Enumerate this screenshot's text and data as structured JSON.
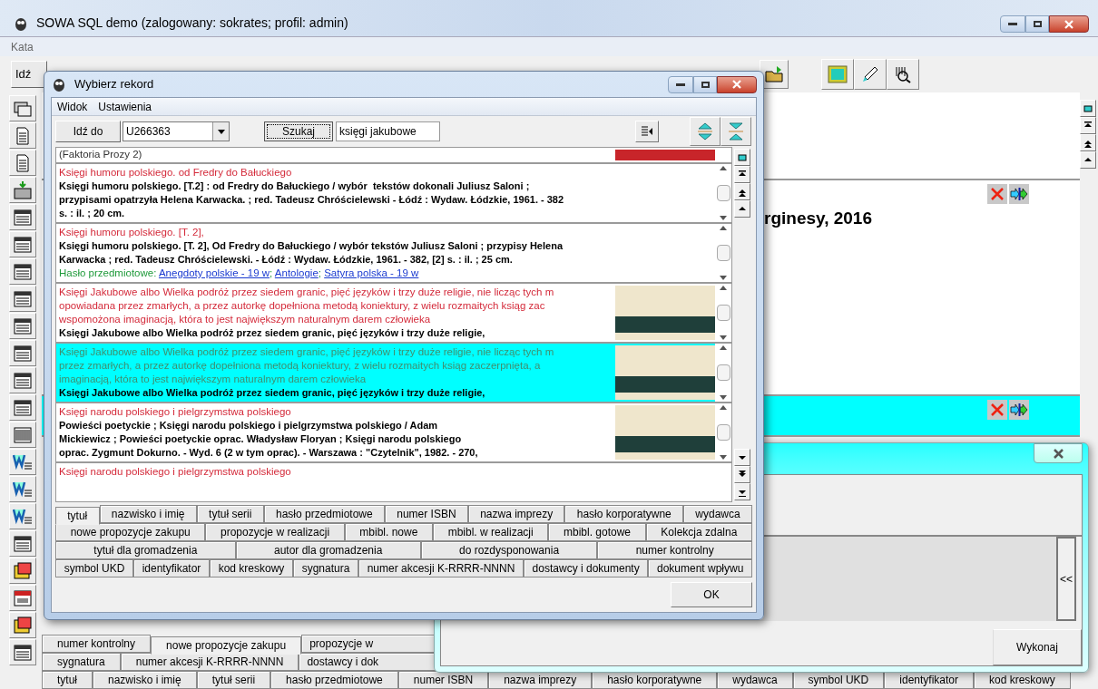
{
  "main_window": {
    "title": "SOWA SQL demo (zalogowany: sokrates; profil: admin)",
    "menu": [
      "Kata"
    ],
    "toolbar_button": "Idź",
    "records": [
      {
        "selected": false,
        "actions": false
      },
      {
        "selected": false,
        "actions": true,
        "text": "rginesy, 2016"
      },
      {
        "selected": true,
        "actions": true
      }
    ],
    "tab_rows": [
      [
        {
          "label": "numer kontrolny",
          "selected": false
        },
        {
          "label": "nowe propozycje zakupu",
          "selected": true
        },
        {
          "label": "propozycje w",
          "selected": false
        }
      ],
      [
        {
          "label": "sygnatura",
          "selected": false
        },
        {
          "label": "numer akcesji K-RRRR-NNNN",
          "selected": false
        },
        {
          "label": "dostawcy i dok",
          "selected": false
        }
      ],
      [
        {
          "label": "tytuł",
          "selected": false
        },
        {
          "label": "nazwisko i imię",
          "selected": false
        },
        {
          "label": "tytuł serii",
          "selected": false
        },
        {
          "label": "hasło przedmiotowe",
          "selected": false
        },
        {
          "label": "numer ISBN",
          "selected": false
        },
        {
          "label": "nazwa imprezy",
          "selected": false
        },
        {
          "label": "hasło korporatywne",
          "selected": false
        },
        {
          "label": "wydawca",
          "selected": false
        },
        {
          "label": "symbol UKD",
          "selected": false
        },
        {
          "label": "identyfikator",
          "selected": false
        },
        {
          "label": "kod kreskowy",
          "selected": false
        }
      ]
    ]
  },
  "dialog": {
    "title": "Wybierz rekord",
    "menu": [
      "Widok",
      "Ustawienia"
    ],
    "goto_button": "Idź do",
    "goto_value": "U266363",
    "search_button": "Szukaj",
    "search_value": "księgi jakubowe",
    "partial_record": "(Faktoria Prozy 2)",
    "records": [
      {
        "selected": false,
        "cover": false,
        "title_lines": [
          "Księgi humoru polskiego. od Fredry do Bałuckiego"
        ],
        "body_lines": [
          "Księgi humoru polskiego. [T.2] : od Fredry do Bałuckiego / wybór  tekstów dokonali Juliusz Saloni ;",
          "przypisami opatrzyła Helena Karwacka. ; red. Tadeusz Chróścielewski - Łódź : Wydaw. Łódzkie, 1961. - 382",
          "s. : il. ; 20 cm."
        ]
      },
      {
        "selected": false,
        "cover": false,
        "title_lines": [
          "Księgi humoru polskiego. [T. 2],"
        ],
        "body_lines": [
          "Księgi humoru polskiego. [T. 2], Od Fredry do Bałuckiego / wybór tekstów Juliusz Saloni ; przypisy Helena",
          "Karwacka ; red. Tadeusz Chróścielewski. - Łódź : Wydaw. Łódzkie, 1961. - 382, [2] s. : il. ; 25 cm."
        ],
        "subject": {
          "label": "Hasło przedmiotowe:",
          "separator": ";",
          "links": [
            "Anegdoty polskie - 19 w",
            "Antologie",
            "Satyra polska - 19 w"
          ]
        }
      },
      {
        "selected": false,
        "cover": true,
        "title_lines": [
          "Księgi Jakubowe albo Wielka podróż przez siedem granic, pięć języków i trzy duże religie, nie licząc tych m",
          "opowiadana przez zmarłych, a przez autorkę dopełniona metodą koniektury, z wielu rozmaitych ksiąg zac",
          "wspomożona imaginacją, która to jest największym naturalnym darem człowieka"
        ],
        "body_lines": [
          "Księgi Jakubowe albo Wielka podróż przez siedem granic, pięć języków i trzy duże religie,"
        ]
      },
      {
        "selected": true,
        "cover": true,
        "title_lines": [
          "Księgi Jakubowe albo Wielka podróż przez siedem granic, pięć języków i trzy duże religie, nie licząc tych m",
          "przez zmarłych, a przez autorkę dopełniona metodą koniektury, z wielu rozmaitych ksiąg zaczerpnięta, a",
          "imaginacją, która to jest największym naturalnym darem człowieka"
        ],
        "body_lines": [
          "Księgi Jakubowe albo Wielka podróż przez siedem granic, pięć języków i trzy duże religie,"
        ]
      },
      {
        "selected": false,
        "cover": true,
        "title_lines": [
          "Księgi narodu polskiego i pielgrzymstwa polskiego"
        ],
        "body_lines": [
          "Powieści poetyckie ; Księgi narodu polskiego i pielgrzymstwa polskiego / Adam",
          "Mickiewicz ; Powieści poetyckie oprac. Władysław Floryan ; Księgi narodu polskiego",
          "oprac. Zygmunt Dokurno. - Wyd. 6 (2 w tym oprac). - Warszawa : \"Czytelnik\", 1982. - 270,"
        ]
      },
      {
        "selected": false,
        "cover": false,
        "title_lines": [
          "Księgi narodu polskiego i pielgrzymstwa polskiego"
        ]
      }
    ],
    "tab_rows": [
      [
        {
          "label": "tytuł",
          "selected": true
        },
        {
          "label": "nazwisko i imię",
          "selected": false
        },
        {
          "label": "tytuł serii",
          "selected": false
        },
        {
          "label": "hasło przedmiotowe",
          "selected": false
        },
        {
          "label": "numer ISBN",
          "selected": false
        },
        {
          "label": "nazwa imprezy",
          "selected": false
        },
        {
          "label": "hasło korporatywne",
          "selected": false
        },
        {
          "label": "wydawca",
          "selected": false
        }
      ],
      [
        {
          "label": "nowe propozycje zakupu",
          "selected": false
        },
        {
          "label": "propozycje w realizacji",
          "selected": false
        },
        {
          "label": "mbibl. nowe",
          "selected": false
        },
        {
          "label": "mbibl. w realizacji",
          "selected": false
        },
        {
          "label": "mbibl. gotowe",
          "selected": false
        },
        {
          "label": "Kolekcja zdalna",
          "selected": false
        }
      ],
      [
        {
          "label": "tytuł dla gromadzenia",
          "selected": false
        },
        {
          "label": "autor dla gromadzenia",
          "selected": false
        },
        {
          "label": "do rozdysponowania",
          "selected": false
        },
        {
          "label": "numer kontrolny",
          "selected": false
        }
      ],
      [
        {
          "label": "symbol UKD",
          "selected": false
        },
        {
          "label": "identyfikator",
          "selected": false
        },
        {
          "label": "kod kreskowy",
          "selected": false
        },
        {
          "label": "sygnatura",
          "selected": false
        },
        {
          "label": "numer akcesji K-RRRR-NNNN",
          "selected": false
        },
        {
          "label": "dostawcy i dokumenty",
          "selected": false
        },
        {
          "label": "dokument wpływu",
          "selected": false
        }
      ]
    ],
    "ok_button": "OK"
  },
  "second_dialog": {
    "collapse_button": "<<",
    "run_button": "Wykonaj"
  }
}
